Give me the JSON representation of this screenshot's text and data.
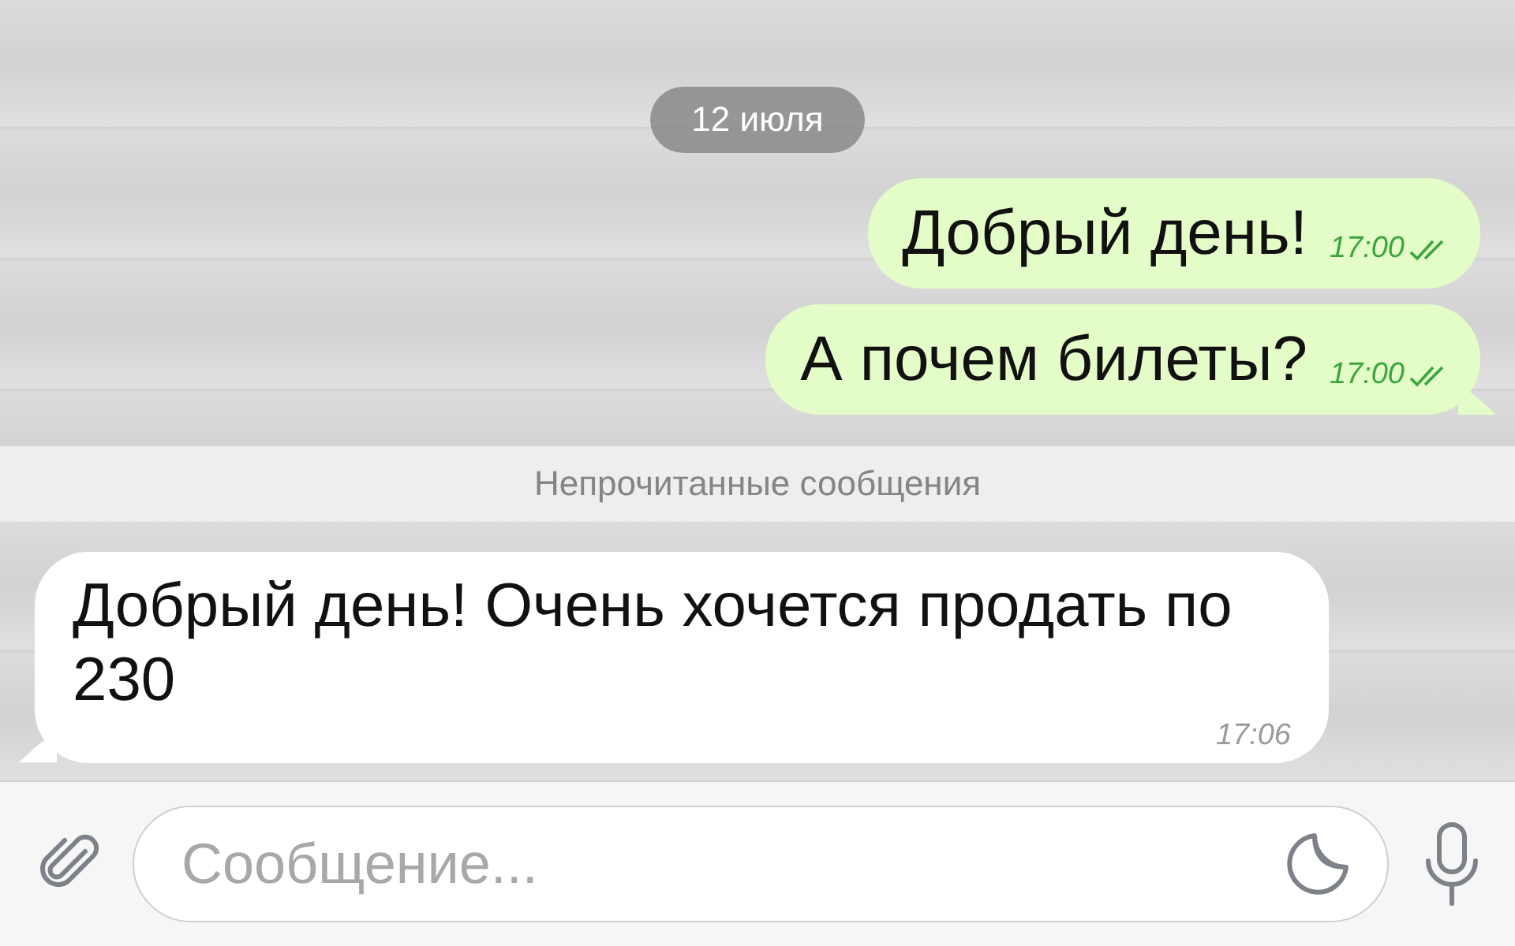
{
  "feed": [
    {
      "kind": "date",
      "text": "12 июля"
    },
    {
      "kind": "message",
      "text": "Добрый день!",
      "time": "17:00",
      "outgoing": true,
      "read": true
    },
    {
      "kind": "message",
      "text": "А почем билеты?",
      "time": "17:00",
      "outgoing": true,
      "read": true
    },
    {
      "kind": "divider",
      "text": "Непрочитанные сообщения"
    },
    {
      "kind": "message",
      "text": "Добрый день! Очень хочется продать по 230",
      "time": "17:06",
      "outgoing": false
    }
  ],
  "composer": {
    "placeholder": "Сообщение..."
  }
}
